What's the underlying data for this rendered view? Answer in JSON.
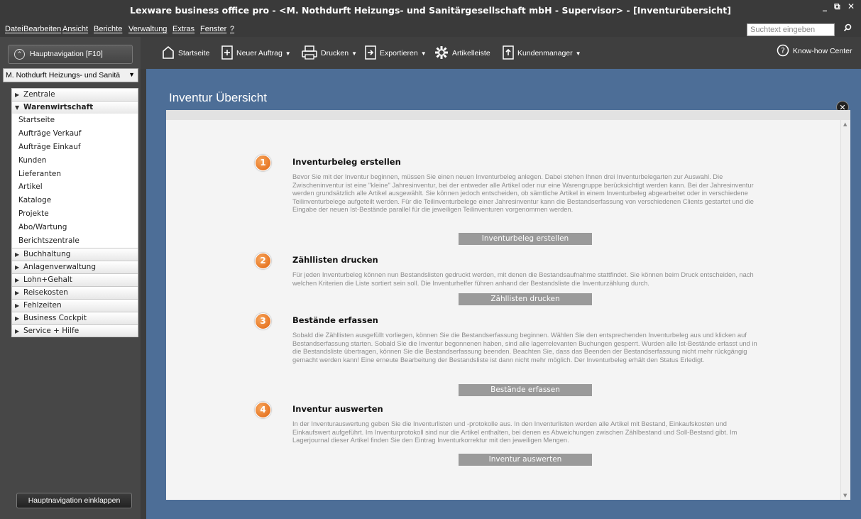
{
  "window": {
    "title": "Lexware business office pro - <M. Nothdurft Heizungs- und Sanitärgesellschaft mbH - Supervisor> - [Inventurübersicht]",
    "controls": "_ ̅ ✕"
  },
  "menu": {
    "items": [
      "Datei",
      "Bearbeiten",
      "Ansicht",
      "Berichte",
      "Verwaltung",
      "Extras",
      "Fenster",
      "?"
    ],
    "search_placeholder": "Suchtext eingeben"
  },
  "sidebar": {
    "hauptnav_label": "Hauptnavigation  [F10]",
    "company": "M. Nothdurft Heizungs- und Sanitä",
    "groups": [
      {
        "label": "Zentrale",
        "open": false
      },
      {
        "label": "Warenwirtschaft",
        "open": true,
        "items": [
          "Startseite",
          "Aufträge Verkauf",
          "Aufträge Einkauf",
          "Kunden",
          "Lieferanten",
          "Artikel",
          "Kataloge",
          "Projekte",
          "Abo/Wartung",
          "Berichtszentrale"
        ]
      },
      {
        "label": "Buchhaltung",
        "open": false
      },
      {
        "label": "Anlagenverwaltung",
        "open": false
      },
      {
        "label": "Lohn+Gehalt",
        "open": false
      },
      {
        "label": "Reisekosten",
        "open": false
      },
      {
        "label": "Fehlzeiten",
        "open": false
      },
      {
        "label": "Business Cockpit",
        "open": false
      },
      {
        "label": "Service + Hilfe",
        "open": false
      }
    ],
    "collapse_label": "Hauptnavigation einklappen"
  },
  "toolbar": {
    "startseite": "Startseite",
    "neuer_auftrag": "Neuer Auftrag",
    "drucken": "Drucken",
    "exportieren": "Exportieren",
    "artikelleiste": "Artikelleiste",
    "kundenmanager": "Kundenmanager",
    "knowhow": "Know-how Center"
  },
  "main": {
    "title": "Inventur Übersicht",
    "steps": [
      {
        "num": "1",
        "heading": "Inventurbeleg erstellen",
        "desc": "Bevor Sie mit der Inventur beginnen, müssen Sie einen neuen Inventurbeleg anlegen. Dabei stehen Ihnen drei Inventurbelegarten zur Auswahl. Die Zwischeninventur ist eine \"kleine\" Jahresinventur, bei der entweder alle Artikel oder nur eine Warengruppe berücksichtigt werden kann. Bei der Jahresinventur werden grundsätzlich alle Artikel ausgewählt. Sie können jedoch entscheiden, ob sämtliche Artikel in einem Inventurbeleg abgearbeitet oder in verschiedene Teilinventurbelege aufgeteilt werden. Für die Teilinventurbelege einer Jahresinventur kann die Bestandserfassung von verschiedenen Clients gestartet und die Eingabe der neuen Ist-Bestände parallel für die jeweiligen Teilinventuren vorgenommen werden.",
        "button": "Inventurbeleg erstellen"
      },
      {
        "num": "2",
        "heading": "Zähllisten drucken",
        "desc": "Für jeden Inventurbeleg können nun Bestandslisten gedruckt werden, mit denen die Bestandsaufnahme stattfindet. Sie können beim Druck entscheiden, nach welchen Kriterien die Liste sortiert sein soll. Die Inventurhelfer führen anhand der Bestandsliste die Inventurzählung durch.",
        "button": "Zähllisten drucken"
      },
      {
        "num": "3",
        "heading": "Bestände erfassen",
        "desc": "Sobald die Zähllisten ausgefüllt vorliegen, können Sie die Bestandserfassung beginnen. Wählen Sie den entsprechenden Inventurbeleg aus und klicken auf Bestandserfassung starten. Sobald Sie die Inventur begonnenen haben, sind alle lagerrelevanten Buchungen gesperrt. Wurden alle Ist-Bestände erfasst und in die Bestandsliste übertragen, können Sie die Bestandserfassung beenden. Beachten Sie, dass das Beenden der Bestandserfassung nicht mehr rückgängig gemacht werden kann! Eine erneute Bearbeitung der Bestandsliste ist dann nicht mehr möglich. Der Inventurbeleg erhält den Status Erledigt.",
        "button": "Bestände erfassen"
      },
      {
        "num": "4",
        "heading": "Inventur auswerten",
        "desc": "In der Inventurauswertung geben Sie die Inventurlisten und -protokolle aus. In den Inventurlisten werden alle Artikel mit Bestand, Einkaufskosten und Einkaufswert aufgeführt. Im Inventurprotokoll sind nur die Artikel enthalten, bei denen es Abweichungen zwischen Zählbestand und Soll-Bestand gibt. Im Lagerjournal dieser Artikel finden Sie den Eintrag Inventurkorrektur mit den jeweiligen Mengen.",
        "button": "Inventur auswerten"
      }
    ]
  },
  "colors": {
    "main_bg": "#4d6e97",
    "step_badge": "#e86f1c",
    "dark_chrome": "#3a3a3a"
  }
}
